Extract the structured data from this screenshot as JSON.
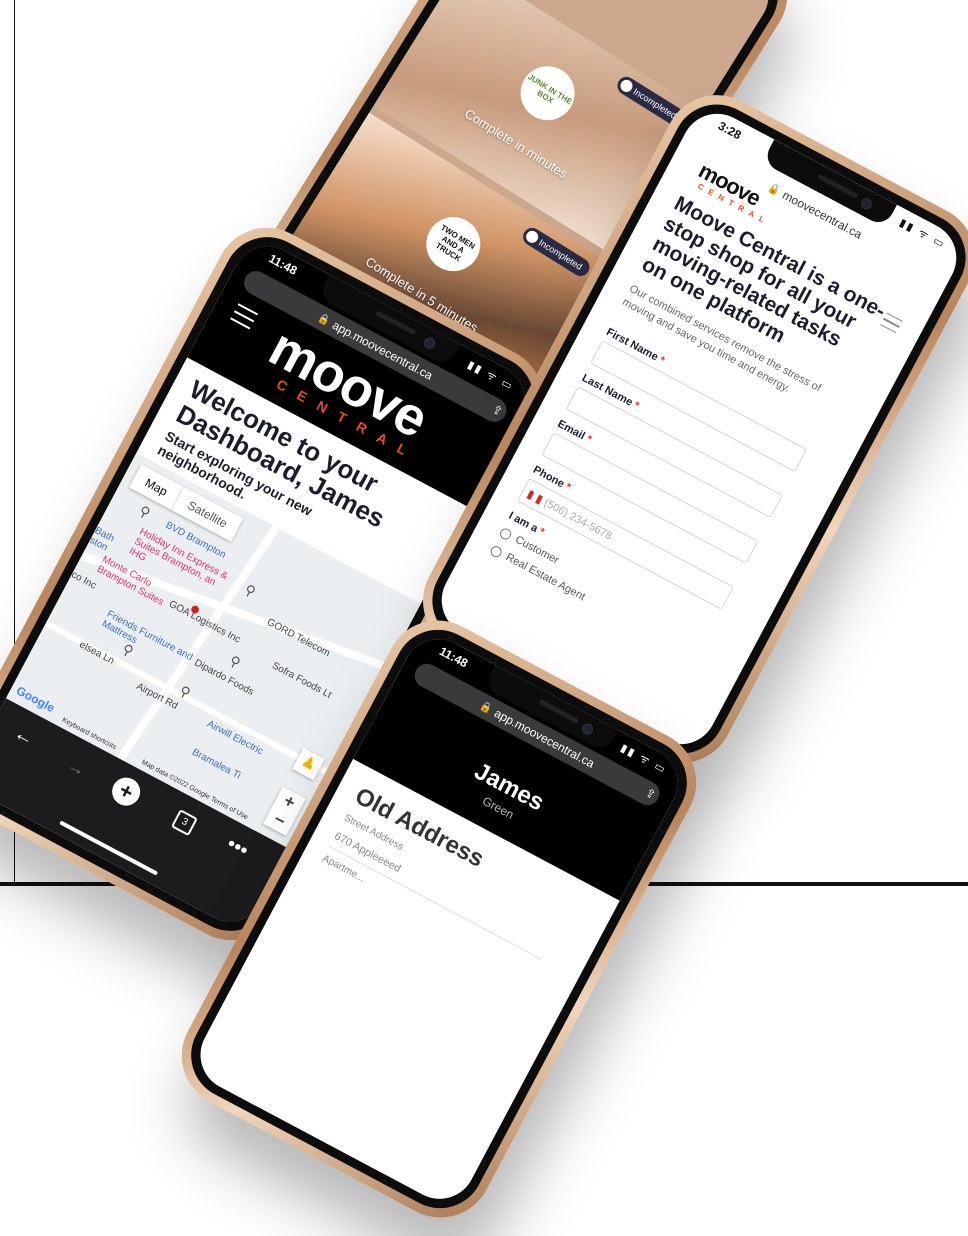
{
  "phone_top": {
    "cards": [
      {
        "logo": "JUNK IN THE BOX",
        "status": "Incompleted",
        "time": "Complete in minutes"
      },
      {
        "logo": "TWO MEN AND A TRUCK",
        "status": "Incompleted",
        "time": "Complete in 5 minutes"
      }
    ]
  },
  "phone_dashboard": {
    "time": "11:48",
    "status_icons": "▮▮ ᯤ ▭",
    "url": "app.moovecentral.ca",
    "logo_main": "moove",
    "logo_sub": "CENTRAL",
    "welcome": "Welcome to your Dashboard, James",
    "subwelcome": "Start exploring your new neighborhood.",
    "map_tabs": [
      "Map",
      "Satellite"
    ],
    "map_labels": {
      "bvd": "BVD Brampton",
      "holiday": "Holiday Inn Express & Suites Brampton, an IHG",
      "monte": "Monte Carlo Brampton Suites",
      "goa": "GOA Logistics Inc",
      "gord": "GORD Telecom",
      "friends": "Friends Furniture and Mattress",
      "dipardo": "Dipardo Foods",
      "airwill": "Airwill Electric",
      "sofra": "Sofra Foods Lt",
      "airport": "Airport Rd",
      "bath": "Bath ston",
      "co": "co Inc",
      "chelsea": "elsea Ln",
      "bramalea": "Bramalea Ti"
    },
    "google": "Google",
    "map_footer": "Keyboard shortcuts",
    "map_footer2": "Map data ©2022 Google  Terms of Use",
    "tabs_count": "3"
  },
  "phone_signup": {
    "time": "3:28",
    "status_icons": "▮▮ ᯤ ▭",
    "url": "moovecentral.ca",
    "logo_main": "moove",
    "logo_sub": "CENTRAL",
    "headline": "Moove Central is a one-stop shop for all your moving-related tasks on one platform",
    "sub": "Our combined services remove the stress of moving and save you time and energy.",
    "fields": {
      "first_name": "First Name",
      "last_name": "Last Name",
      "email": "Email",
      "phone": "Phone",
      "phone_placeholder": "(506) 234-5678",
      "iam": "I am a"
    },
    "required_mark": "*",
    "options": [
      "Customer",
      "Real Estate Agent"
    ]
  },
  "phone_address": {
    "time": "11:48",
    "status_icons": "▮▮ ᯤ ▭",
    "url": "app.moovecentral.ca",
    "name": "James",
    "subname": "Green",
    "section": "Old Address",
    "street_label": "Street Address",
    "street_value": "670 Appleeeed",
    "apt_label": "Apartme..."
  },
  "colors": {
    "accent_orange": "#e84a2a",
    "dark_text": "#1b1d2e",
    "phone_gold": "#c89467"
  },
  "icons": [
    "lock-icon",
    "share-icon",
    "menu-icon",
    "back-icon",
    "forward-icon",
    "plus-icon",
    "tabs-icon",
    "more-icon",
    "pin-icon",
    "pegman-icon",
    "zoom-in-icon",
    "zoom-out-icon"
  ]
}
